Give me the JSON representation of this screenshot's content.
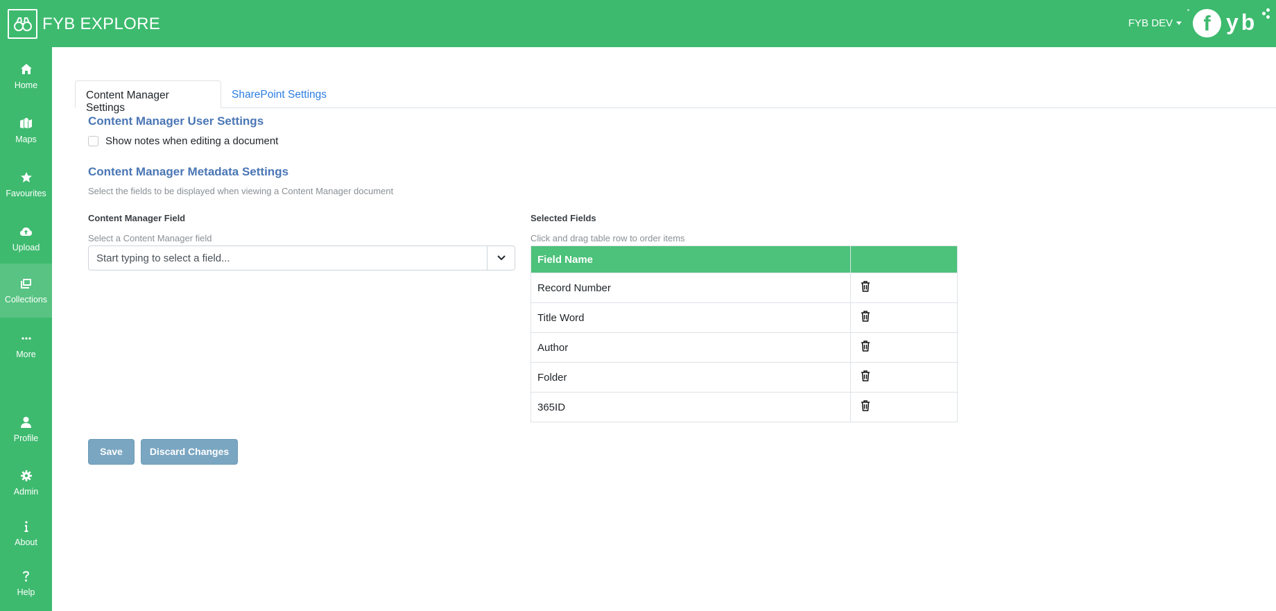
{
  "header": {
    "app_title": "FYB EXPLORE",
    "user_label": "FYB DEV",
    "logo_text_f": "f",
    "logo_text_yb": "yb",
    "brand_color": "#3dba6e"
  },
  "sidebar": {
    "items": [
      {
        "label": "Home",
        "icon": "home-icon"
      },
      {
        "label": "Maps",
        "icon": "map-icon"
      },
      {
        "label": "Favourites",
        "icon": "star-icon"
      },
      {
        "label": "Upload",
        "icon": "cloud-upload-icon"
      },
      {
        "label": "Collections",
        "icon": "collections-icon",
        "active": true
      },
      {
        "label": "More",
        "icon": "ellipsis-icon"
      },
      {
        "label": "Profile",
        "icon": "user-icon"
      },
      {
        "label": "Admin",
        "icon": "gear-icon"
      },
      {
        "label": "About",
        "icon": "info-icon"
      },
      {
        "label": "Help",
        "icon": "question-icon"
      }
    ]
  },
  "tabs": [
    {
      "label": "Content Manager Settings",
      "active": true
    },
    {
      "label": "SharePoint Settings",
      "active": false
    }
  ],
  "user_settings": {
    "title": "Content Manager User Settings",
    "show_notes_label": "Show notes when editing a document",
    "show_notes_checked": false
  },
  "metadata_settings": {
    "title": "Content Manager Metadata Settings",
    "description": "Select the fields to be displayed when viewing a Content Manager document",
    "field_heading": "Content Manager Field",
    "field_hint": "Select a Content Manager field",
    "field_placeholder": "Start typing to select a field...",
    "selected_heading": "Selected Fields",
    "selected_hint": "Click and drag table row to order items",
    "table_header": "Field Name",
    "selected_fields": [
      "Record Number",
      "Title Word",
      "Author",
      "Folder",
      "365ID"
    ]
  },
  "actions": {
    "save_label": "Save",
    "discard_label": "Discard Changes"
  }
}
